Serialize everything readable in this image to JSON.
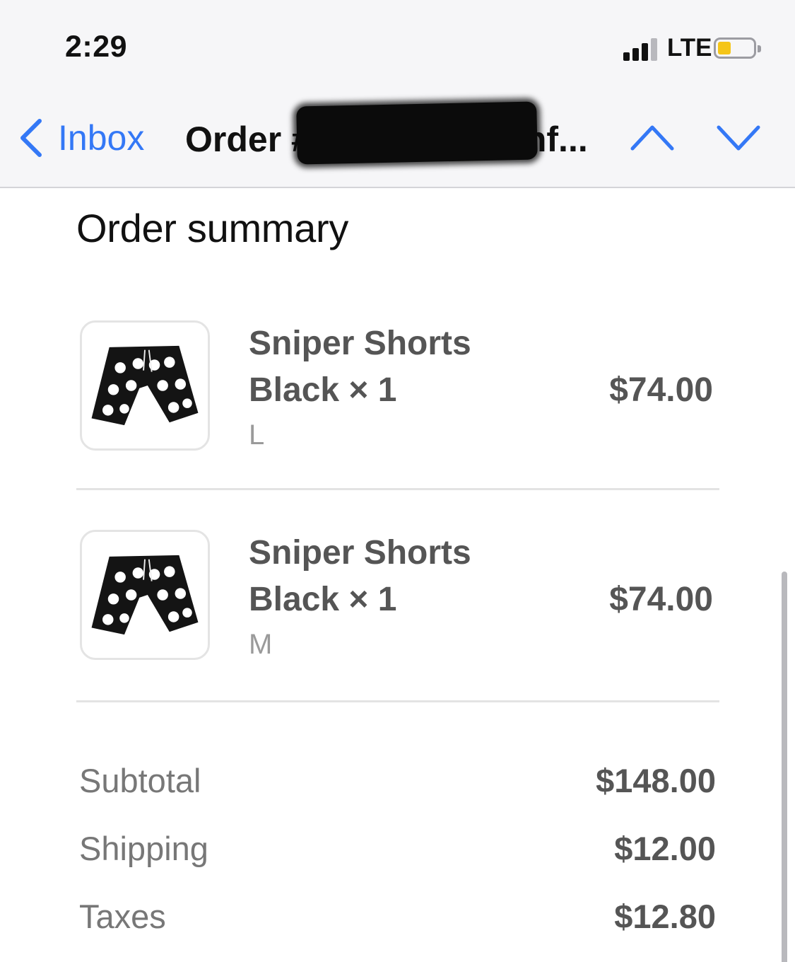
{
  "status_bar": {
    "time": "2:29",
    "network": "LTE",
    "signal_bars": 4,
    "signal_bars_filled": 3,
    "battery_level_fraction": 0.25,
    "battery_color": "#f5c518"
  },
  "nav": {
    "back_label": "Inbox",
    "title": "Order #A9299337 conf...",
    "accent_color": "#3478f6",
    "prev_icon": "chevron-up-icon",
    "next_icon": "chevron-down-icon"
  },
  "summary": {
    "title": "Order summary",
    "items": [
      {
        "name": "Sniper Shorts",
        "variant": "Black × 1",
        "size": "L",
        "price": "$74.00",
        "image": "black-shorts-thumbnail"
      },
      {
        "name": "Sniper Shorts",
        "variant": "Black × 1",
        "size": "M",
        "price": "$74.00",
        "image": "black-shorts-thumbnail"
      }
    ],
    "totals": [
      {
        "label": "Subtotal",
        "value": "$148.00"
      },
      {
        "label": "Shipping",
        "value": "$12.00"
      },
      {
        "label": "Taxes",
        "value": "$12.80"
      }
    ]
  }
}
